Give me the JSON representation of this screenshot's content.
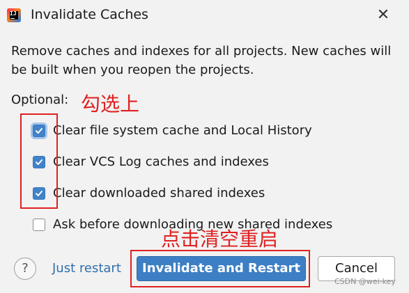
{
  "window": {
    "title": "Invalidate Caches",
    "app_icon_text": "IJ"
  },
  "description": "Remove caches and indexes for all projects. New caches will be built when you reopen the projects.",
  "optional_label": "Optional:",
  "options": [
    {
      "label": "Clear file system cache and Local History",
      "checked": true
    },
    {
      "label": "Clear VCS Log caches and indexes",
      "checked": true
    },
    {
      "label": "Clear downloaded shared indexes",
      "checked": true
    },
    {
      "label": "Ask before downloading new shared indexes",
      "checked": false
    }
  ],
  "annotations": {
    "select_note": "勾选上",
    "restart_note": "点击清空重启",
    "color": "#e02020"
  },
  "footer": {
    "help_label": "?",
    "just_restart_label": "Just restart",
    "invalidate_restart_label": "Invalidate and Restart",
    "cancel_label": "Cancel"
  },
  "watermark": "CSDN @wei-key",
  "colors": {
    "accent": "#3d7fc4",
    "link": "#2f6fae",
    "background": "#f2f2f2"
  }
}
